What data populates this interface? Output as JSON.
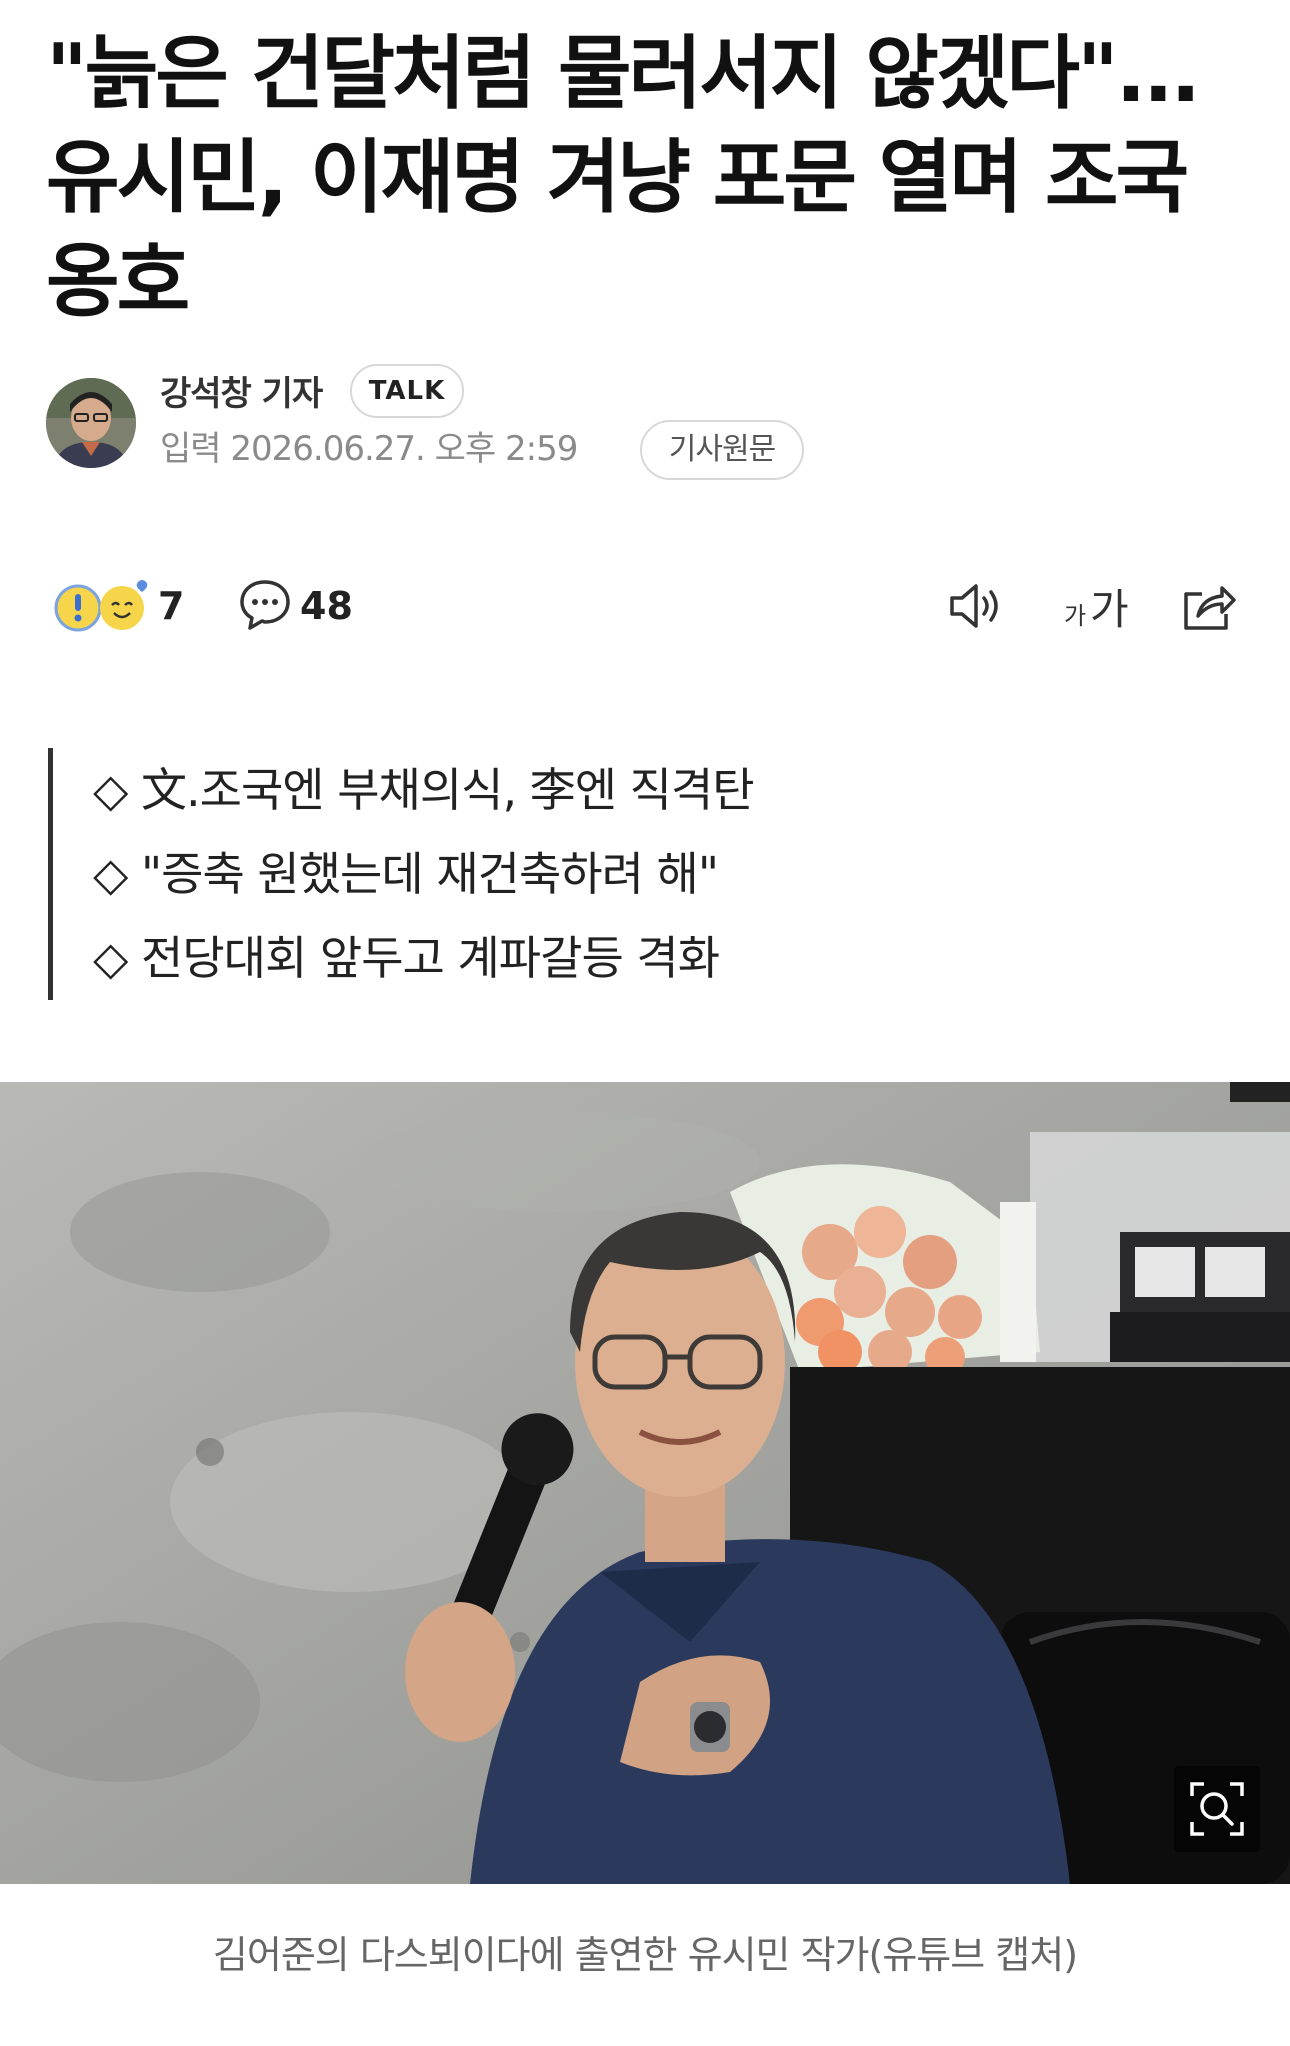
{
  "article": {
    "headline": "\"늙은 건달처럼 물러서지 않겠다\"... 유시민, 이재명 겨냥 포문 열며 조국 옹호"
  },
  "byline": {
    "reporter": "강석창 기자",
    "talk_label": "TALK",
    "date": "입력 2026.06.27. 오후 2:59",
    "original_label": "기사원문"
  },
  "toolbar": {
    "reaction_count": "7",
    "comment_count": "48",
    "font_size_label": "가가",
    "icons": [
      "reaction-emoji-icon",
      "comment-icon",
      "speaker-icon",
      "font-size-icon",
      "share-icon"
    ]
  },
  "summary": [
    "◇ 文.조국엔 부채의식, 李엔 직격탄",
    "◇ \"증축 원했는데 재건축하려 해\"",
    "◇ 전당대회 앞두고 계파갈등 격화"
  ],
  "photo": {
    "caption": "김어준의 다스뵈이다에 출연한 유시민 작가(유튜브 캡처)"
  }
}
